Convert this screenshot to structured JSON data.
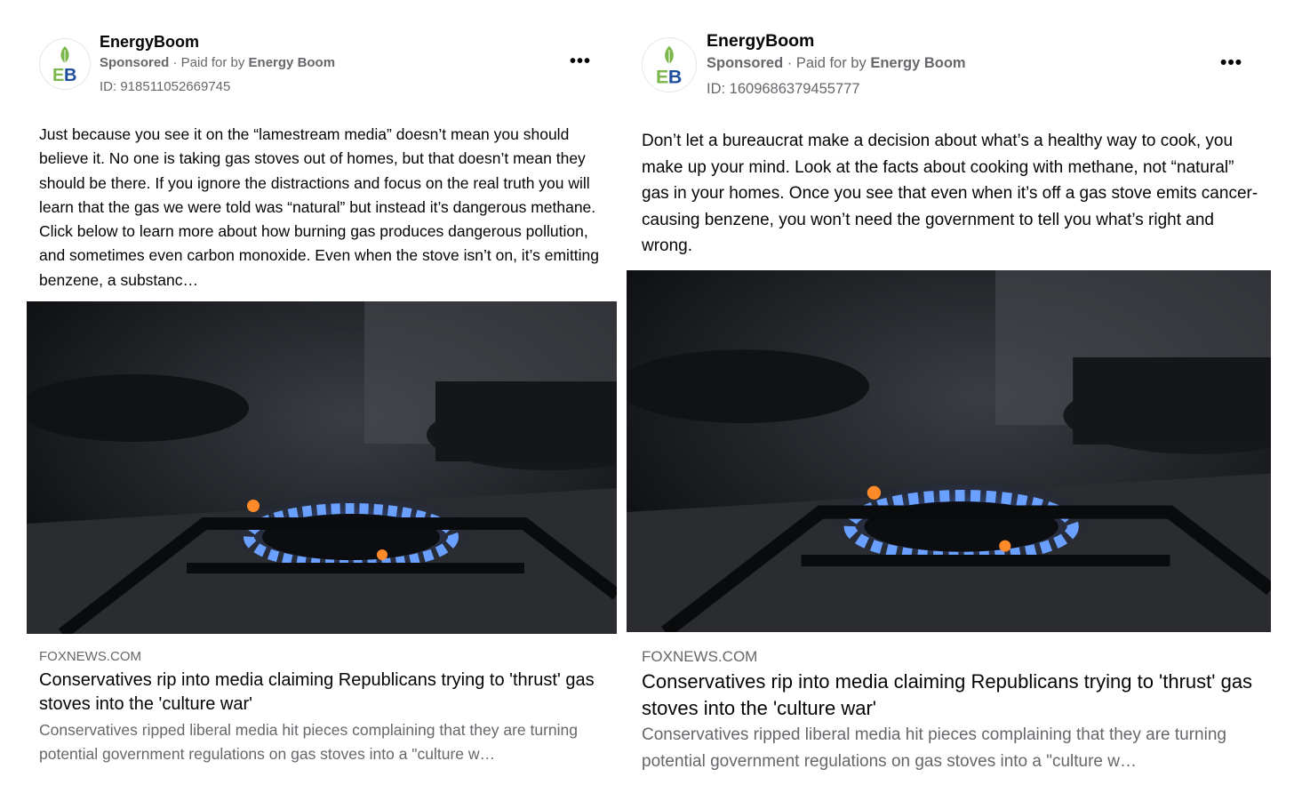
{
  "ads": [
    {
      "advertiser": "EnergyBoom",
      "avatar_text": "EB",
      "sponsored_label": "Sponsored",
      "paid_for_prefix": " · Paid for by ",
      "paid_for_by": "Energy Boom",
      "ad_id": "ID: 918511052669745",
      "more_icon": "more-options-icon",
      "body_text": "Just because you see it on the “lamestream media” doesn’t mean you should believe it. No one is taking gas stoves out of homes, but that doesn’t mean they should be there. If you ignore the distractions and focus on the real truth you will learn that the gas we were told was “natural” but instead it’s dangerous methane. Click below to learn more about how burning gas produces dangerous pollution, and sometimes even carbon monoxide. Even when the stove isn’t on, it’s emitting benzene, a substanc…",
      "link_domain": "FOXNEWS.COM",
      "link_headline": "Conservatives rip into media claiming Republicans trying to 'thrust' gas stoves into the 'culture war'",
      "link_description": "Conservatives ripped liberal media hit pieces complaining that they are turning potential government regulations on gas stoves into a \"culture w…"
    },
    {
      "advertiser": "EnergyBoom",
      "avatar_text": "EB",
      "sponsored_label": "Sponsored",
      "paid_for_prefix": " · Paid for by ",
      "paid_for_by": "Energy Boom",
      "ad_id": "ID: 1609686379455777",
      "more_icon": "more-options-icon",
      "body_text": "Don’t let a bureaucrat make a decision about what’s a healthy way to cook, you make up your mind. Look at the facts about cooking with methane, not “natural” gas in your homes. Once you see that even when it’s off a gas stove emits cancer-causing benzene, you won’t need the government to tell you what’s right and wrong.",
      "link_domain": "FOXNEWS.COM",
      "link_headline": "Conservatives rip into media claiming Republicans trying to 'thrust' gas stoves into the 'culture war'",
      "link_description": "Conservatives ripped liberal media hit pieces complaining that they are turning potential government regulations on gas stoves into a \"culture w…"
    }
  ],
  "colors": {
    "brand_green": "#7ab648",
    "brand_blue": "#1f4e9c",
    "flame_blue": "#3a7bff",
    "secondary_text": "#65676b"
  }
}
